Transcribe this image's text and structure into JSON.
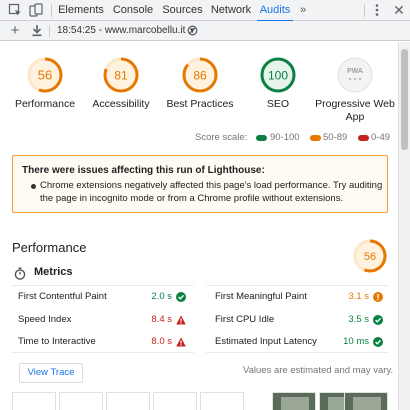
{
  "devtools": {
    "tabs": [
      {
        "label": "Elements"
      },
      {
        "label": "Console"
      },
      {
        "label": "Sources"
      },
      {
        "label": "Network"
      },
      {
        "label": "Audits",
        "active": true
      }
    ],
    "more": "»"
  },
  "toolbar": {
    "report_label": "18:54:25 - www.marcobellu.it",
    "caret": "▼"
  },
  "scores": [
    {
      "label": "Performance",
      "value": "56",
      "color": "#e67700",
      "fraction": 0.56
    },
    {
      "label": "Accessibility",
      "value": "81",
      "color": "#e67700",
      "fraction": 0.81
    },
    {
      "label": "Best Practices",
      "value": "86",
      "color": "#e67700",
      "fraction": 0.86
    },
    {
      "label": "SEO",
      "value": "100",
      "color": "#0b8043",
      "fraction": 1.0
    },
    {
      "label": "Progressive Web App",
      "badge": "PWA"
    }
  ],
  "scale": {
    "label": "Score scale:",
    "ranges": [
      {
        "label": "90-100",
        "color": "#0b8043"
      },
      {
        "label": "50-89",
        "color": "#e67700"
      },
      {
        "label": "0-49",
        "color": "#c5221f"
      }
    ]
  },
  "warning": {
    "title": "There were issues affecting this run of Lighthouse:",
    "items": [
      "Chrome extensions negatively affected this page's load performance. Try auditing the page in incognito mode or from a Chrome profile without extensions."
    ]
  },
  "performance": {
    "title": "Performance",
    "score": "56",
    "fraction": 0.56,
    "color": "#e67700",
    "metrics_title": "Metrics",
    "metrics": [
      {
        "label": "First Contentful Paint",
        "value": "2.0 s",
        "status": "pass"
      },
      {
        "label": "First Meaningful Paint",
        "value": "3.1 s",
        "status": "average"
      },
      {
        "label": "Speed Index",
        "value": "8.4 s",
        "status": "fail"
      },
      {
        "label": "First CPU Idle",
        "value": "3.5 s",
        "status": "pass"
      },
      {
        "label": "Time to Interactive",
        "value": "8.0 s",
        "status": "fail"
      },
      {
        "label": "Estimated Input Latency",
        "value": "10 ms",
        "status": "pass"
      }
    ],
    "view_trace": "View Trace",
    "footnote": "Values are estimated and may vary."
  }
}
